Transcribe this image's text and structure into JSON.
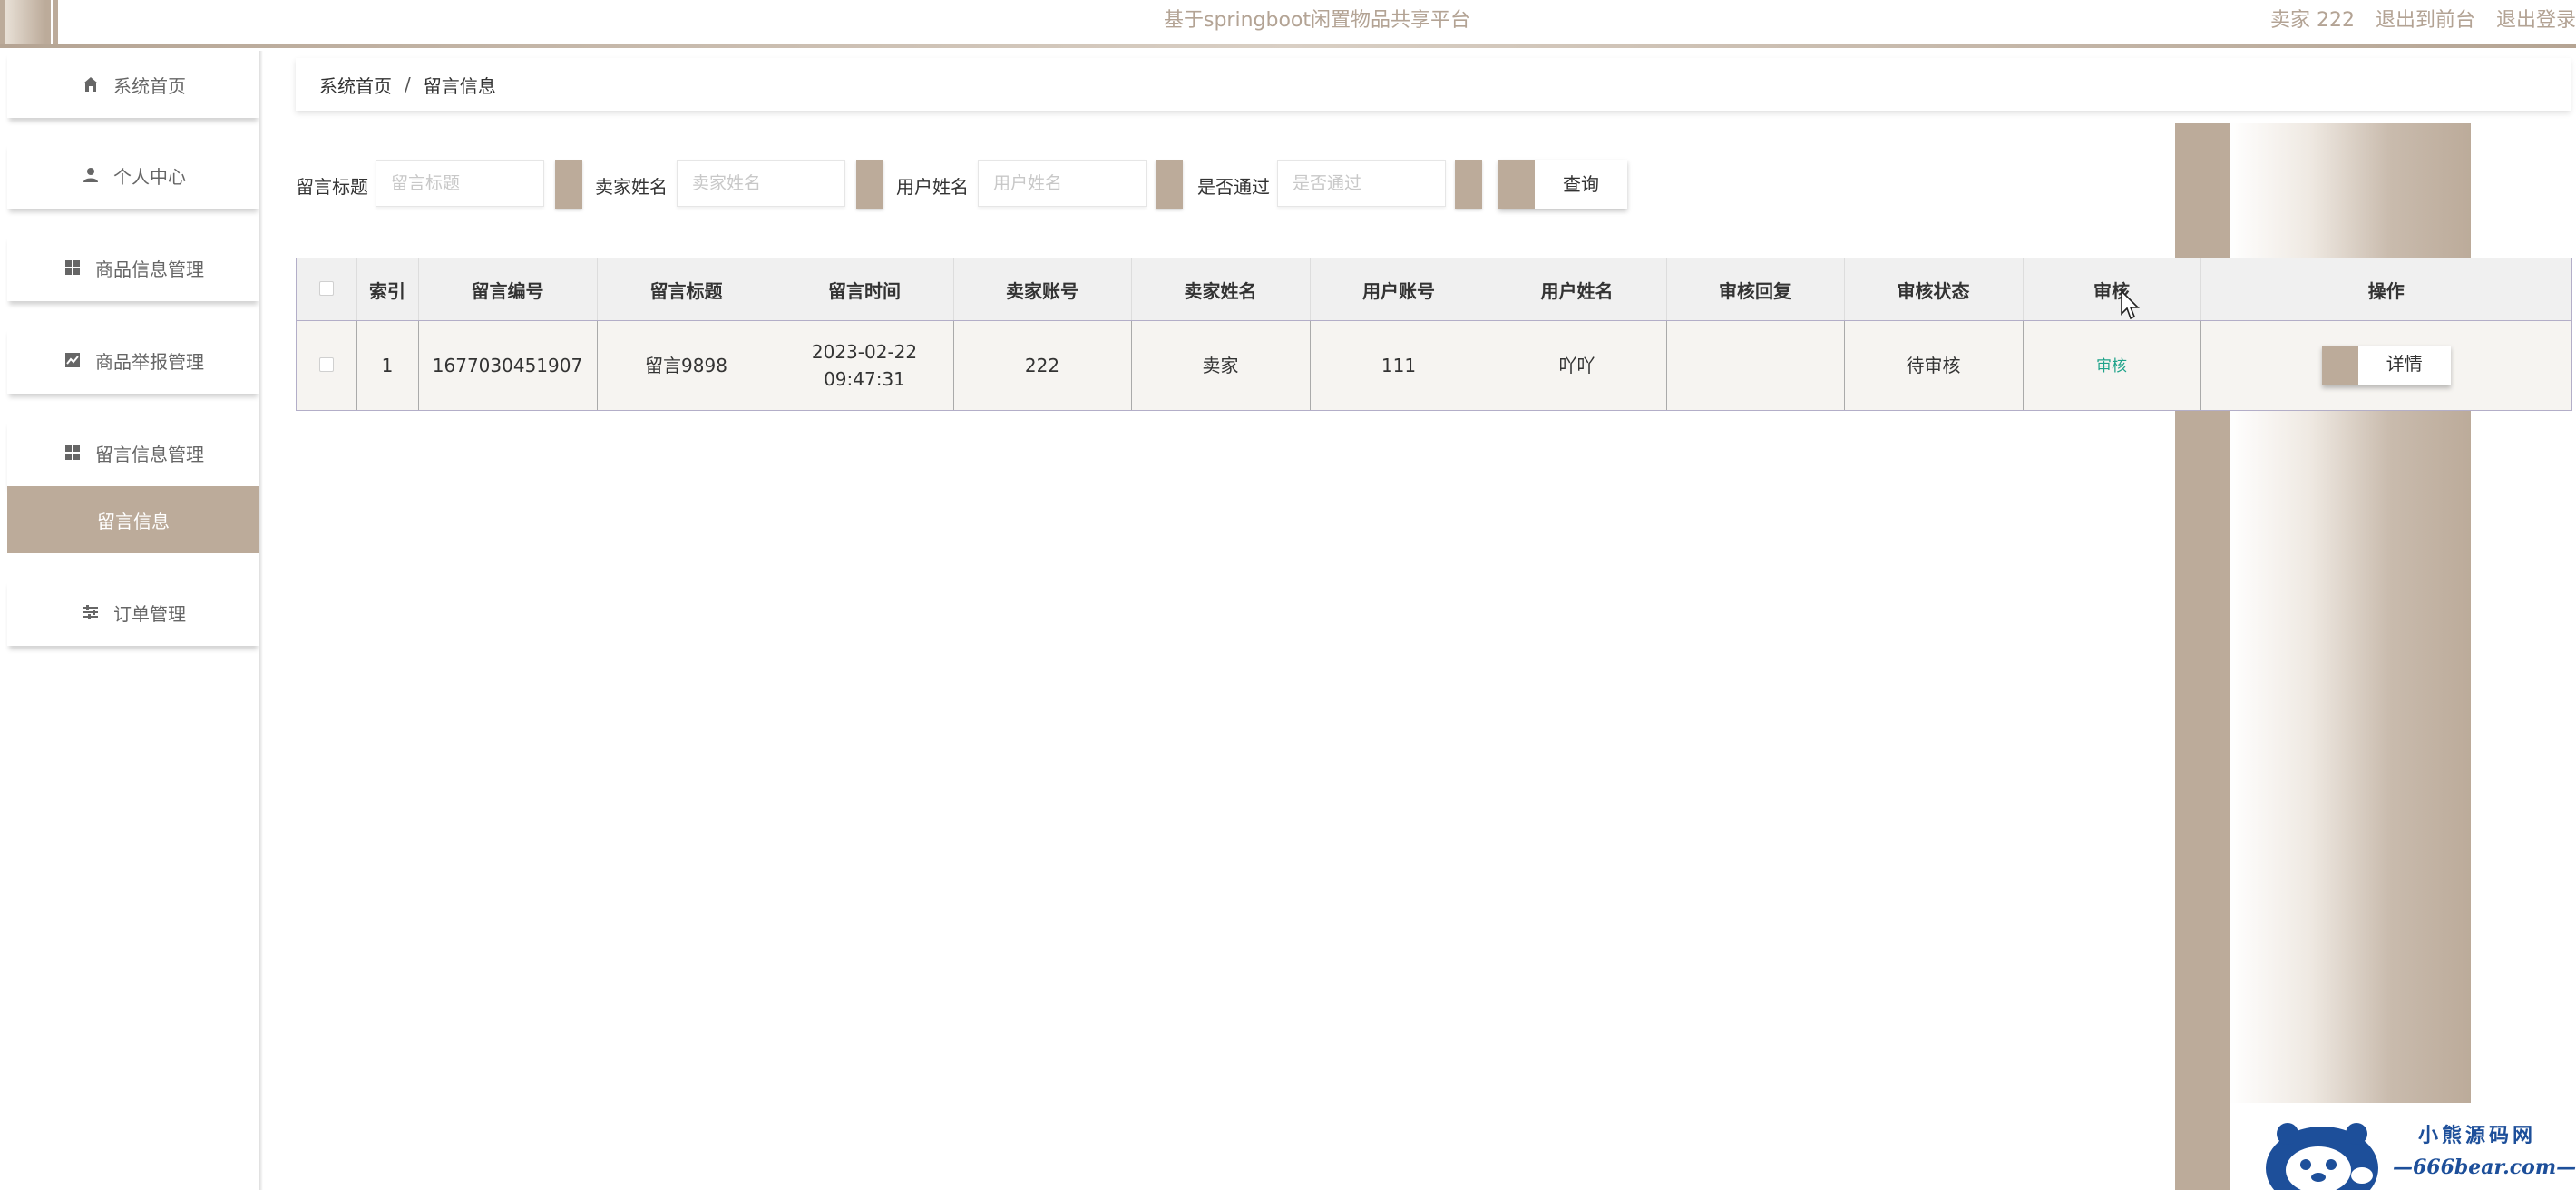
{
  "header": {
    "app_title": "基于springboot闲置物品共享平台",
    "user_label": "卖家 222",
    "back_to_front": "退出到前台",
    "logout": "退出登录"
  },
  "sidebar": {
    "items": [
      {
        "label": "系统首页",
        "icon": "home-icon"
      },
      {
        "label": "个人中心",
        "icon": "user-icon"
      },
      {
        "label": "商品信息管理",
        "icon": "grid-icon"
      },
      {
        "label": "商品举报管理",
        "icon": "chart-icon"
      },
      {
        "label": "留言信息管理",
        "icon": "grid-icon"
      },
      {
        "label": "订单管理",
        "icon": "sliders-icon"
      }
    ],
    "active_sub_item": "留言信息"
  },
  "breadcrumb": {
    "home": "系统首页",
    "separator": "/",
    "current": "留言信息"
  },
  "search": {
    "fields": [
      {
        "label": "留言标题",
        "placeholder": "留言标题",
        "value": ""
      },
      {
        "label": "卖家姓名",
        "placeholder": "卖家姓名",
        "value": ""
      },
      {
        "label": "用户姓名",
        "placeholder": "用户姓名",
        "value": ""
      },
      {
        "label": "是否通过",
        "placeholder": "是否通过",
        "value": ""
      }
    ],
    "query_button": "查询"
  },
  "table": {
    "columns": [
      "索引",
      "留言编号",
      "留言标题",
      "留言时间",
      "卖家账号",
      "卖家姓名",
      "用户账号",
      "用户姓名",
      "审核回复",
      "审核状态",
      "审核",
      "操作"
    ],
    "rows": [
      {
        "index": "1",
        "message_no": "1677030451907",
        "title": "留言9898",
        "time": "2023-02-22 09:47:31",
        "seller_account": "222",
        "seller_name": "卖家",
        "user_account": "111",
        "user_name": "吖吖",
        "audit_reply": "",
        "audit_status": "待审核",
        "audit_link": "审核",
        "detail_button": "详情"
      }
    ]
  },
  "watermark": {
    "line1": "小熊源码网",
    "line2": "—666bear.com—"
  },
  "colors": {
    "accent": "#bcab9a",
    "title_text": "#b3a394",
    "audit_link": "#1fa38a",
    "watermark_blue": "#1d4f9a"
  }
}
